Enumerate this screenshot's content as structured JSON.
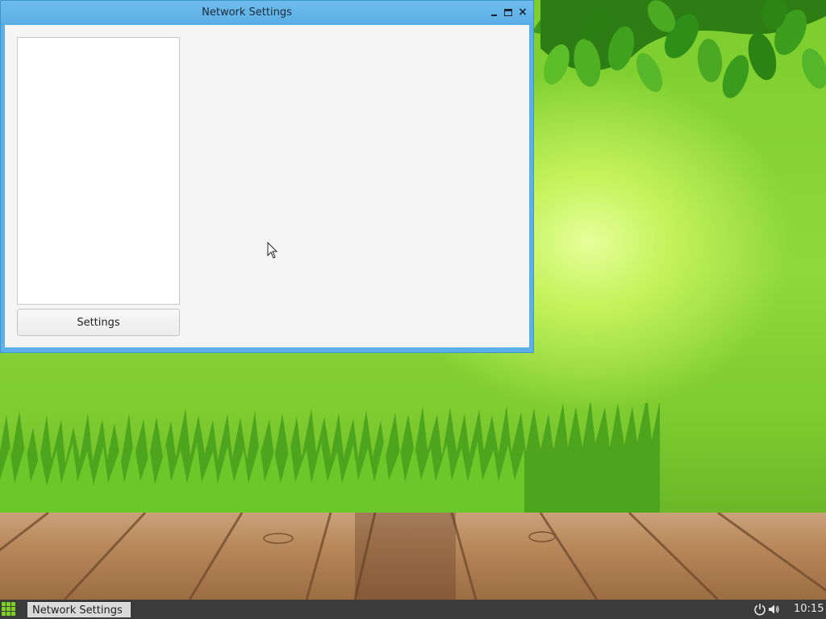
{
  "window": {
    "title": "Network Settings",
    "controls": {
      "minimize": "minimize",
      "maximize": "maximize",
      "close": "close"
    },
    "settings_button_label": "Settings"
  },
  "taskbar": {
    "task_item_label": "Network Settings",
    "clock": "10:15",
    "icons": [
      "start-menu-icon",
      "power-icon",
      "volume-icon"
    ]
  },
  "colors": {
    "titlebar": "#5aaee4",
    "accent_green": "#7ed321",
    "taskbar": "#3b3b3b"
  }
}
